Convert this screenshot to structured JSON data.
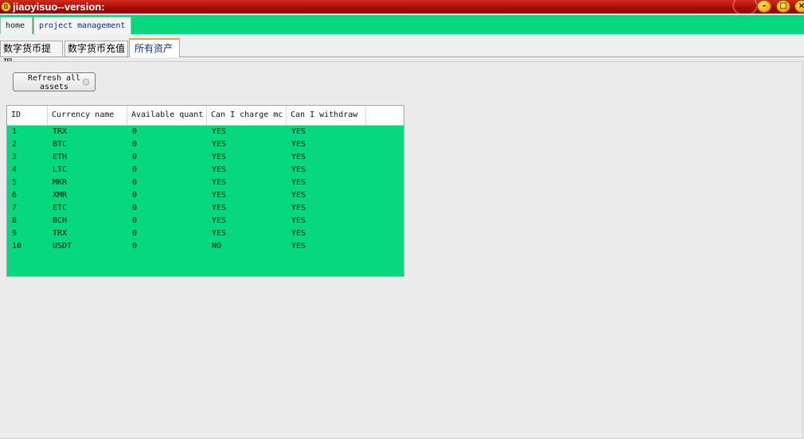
{
  "window": {
    "title": "jiaoyisuo--version:",
    "app_icon": "B",
    "min_label": "–",
    "max_label": "□",
    "close_label": "×"
  },
  "top_tabs": [
    {
      "label": "home"
    },
    {
      "label": "project management"
    }
  ],
  "sub_tabs": [
    {
      "label": "数字货币提现"
    },
    {
      "label": "数字货币充值"
    },
    {
      "label": "所有资产"
    }
  ],
  "toolbar": {
    "refresh_label_line1": "Refresh all",
    "refresh_label_line2": "assets",
    "refresh_icon": "gear-icon"
  },
  "table": {
    "columns": [
      "ID",
      "Currency name",
      "Available quant",
      "Can I charge mc",
      "Can I withdraw"
    ],
    "rows": [
      [
        "1",
        "TRX",
        "0",
        "YES",
        "YES"
      ],
      [
        "2",
        "BTC",
        "0",
        "YES",
        "YES"
      ],
      [
        "3",
        "ETH",
        "0",
        "YES",
        "YES"
      ],
      [
        "4",
        "LTC",
        "0",
        "YES",
        "YES"
      ],
      [
        "5",
        "MKR",
        "0",
        "YES",
        "YES"
      ],
      [
        "6",
        "XMR",
        "0",
        "YES",
        "YES"
      ],
      [
        "7",
        "ETC",
        "0",
        "YES",
        "YES"
      ],
      [
        "8",
        "BCH",
        "0",
        "YES",
        "YES"
      ],
      [
        "9",
        "TRX",
        "0",
        "YES",
        "YES"
      ],
      [
        "10",
        "USDT",
        "0",
        "NO",
        "YES"
      ]
    ]
  },
  "colors": {
    "titlebar": "#a30c06",
    "accent_green": "#06d87f",
    "active_tab_highlight": "#e8a34a"
  }
}
